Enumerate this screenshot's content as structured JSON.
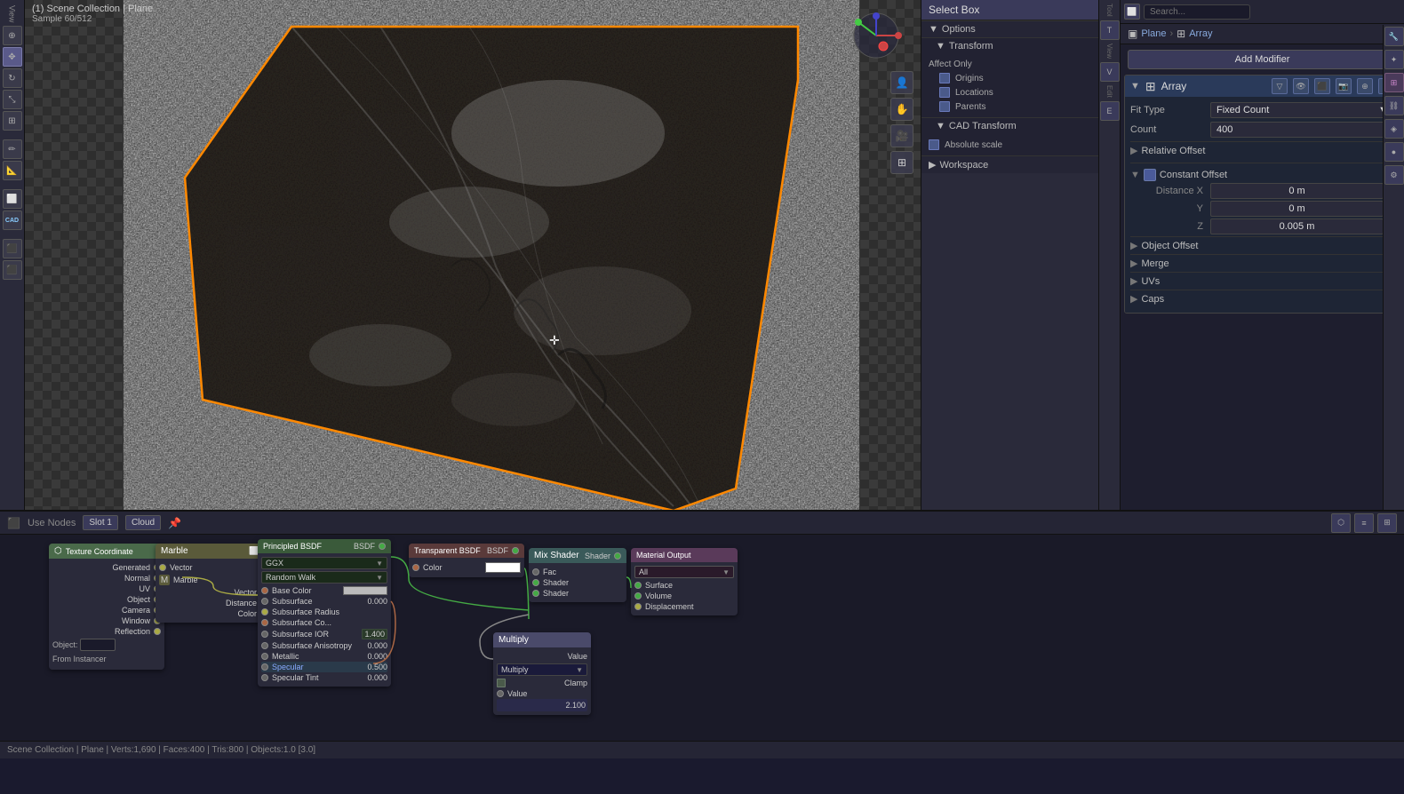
{
  "scene": {
    "title": "(1) Scene Collection | Plane",
    "sample": "Sample 60/512"
  },
  "selectbox": {
    "label": "Select Box"
  },
  "options": {
    "title": "Options",
    "transform": {
      "label": "Transform",
      "affect_only": "Affect Only",
      "origins": "Origins",
      "locations": "Locations",
      "parents": "Parents"
    },
    "cad_transform": {
      "label": "CAD Transform",
      "absolute_scale": "Absolute scale"
    },
    "workspace": {
      "label": "Workspace"
    }
  },
  "modifier_panel": {
    "plane_label": "Plane",
    "array_label": "Array",
    "add_modifier": "Add Modifier",
    "array": {
      "name": "Array",
      "fit_type_label": "Fit Type",
      "fit_type_value": "Fixed Count",
      "count_label": "Count",
      "count_value": "400",
      "relative_offset": "Relative Offset",
      "constant_offset": "Constant Offset",
      "distance_x_label": "Distance X",
      "distance_x_value": "0 m",
      "distance_y_label": "Y",
      "distance_y_value": "0 m",
      "distance_z_label": "Z",
      "distance_z_value": "0.005 m",
      "object_offset": "Object Offset",
      "merge": "Merge",
      "uvs": "UVs",
      "caps": "Caps"
    }
  },
  "node_editor": {
    "header": {
      "slot": "Slot 1",
      "material": "Cloud"
    },
    "nodes": {
      "tex_coord": {
        "title": "Texture Coordinate",
        "outputs": [
          "Generated",
          "Normal",
          "UV",
          "Object",
          "Camera",
          "Window",
          "Reflection"
        ],
        "object_label": "Object:",
        "from_instancer": "From Instancer"
      },
      "marble": {
        "title": "Marble",
        "inputs": [
          "Vector"
        ],
        "outputs": [
          "Vector",
          "Distance",
          "Color"
        ],
        "marble_label": "Marble"
      },
      "principled": {
        "title": "Principled BSDF",
        "output": "BSDF",
        "fields": {
          "distribution": "GGX",
          "subsurface_method": "Random Walk",
          "base_color": "Base Color",
          "subsurface": "Subsurface",
          "subsurface_val": "0.000",
          "subsurface_radius": "Subsurface Radius",
          "subsurface_color": "Subsurface Co...",
          "subsurface_ior": "Subsurface IOR",
          "subsurface_ior_val": "1.400",
          "subsurface_anisotropy": "Subsurface Anisotropy",
          "subsurface_anisotropy_val": "0.000",
          "metallic": "Metallic",
          "metallic_val": "0.000",
          "specular": "Specular",
          "specular_val": "0.500",
          "specular_tint": "Specular Tint",
          "specular_tint_val": "0.000"
        }
      },
      "transparent": {
        "title": "Transparent BSDF",
        "output": "BSDF",
        "color_label": "Color"
      },
      "mix_shader": {
        "title": "Mix Shader",
        "output": "Shader",
        "inputs": [
          "Fac",
          "Shader",
          "Shader"
        ]
      },
      "material_output": {
        "title": "Material Output",
        "target": "All",
        "inputs": [
          "Surface",
          "Volume",
          "Displacement"
        ]
      },
      "multiply": {
        "title": "Multiply",
        "value_label": "Value",
        "operation": "Multiply",
        "clamp": "Clamp",
        "value2_label": "Value",
        "value2_val": "2.100"
      }
    }
  },
  "status_bar": {
    "text": "Scene Collection | Plane | Verts:1,690 | Faces:400 | Tris:800 | Objects:1.0 [3.0]"
  },
  "toolbar": {
    "tools": [
      "cursor",
      "move",
      "rotate",
      "scale",
      "transform",
      "annotate",
      "measure",
      "add",
      "cad",
      "render",
      "camera"
    ]
  }
}
